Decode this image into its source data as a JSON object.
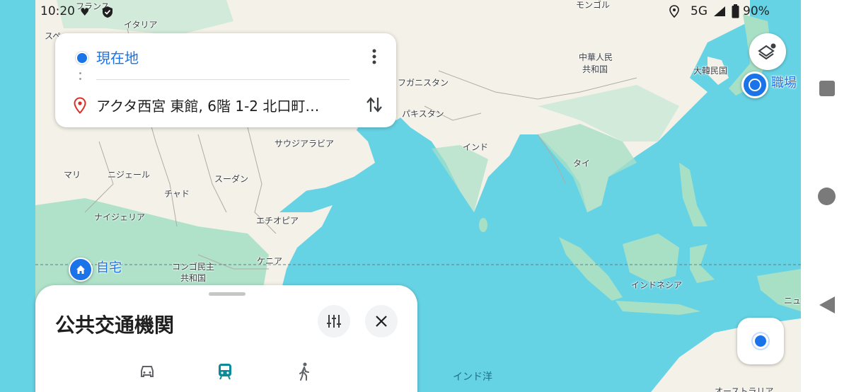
{
  "status_bar": {
    "time": "10:20",
    "network": "5G",
    "battery": "90%"
  },
  "map": {
    "labels": {
      "france": "フランス",
      "italy": "イタリア",
      "spain": "スペ",
      "mongolia": "モンゴル",
      "china_line1": "中華人民",
      "china_line2": "共和国",
      "korea": "大韓民国",
      "afghanistan": "フガニスタン",
      "pakistan": "パキスタン",
      "india": "インド",
      "saudi": "サウジアラビア",
      "mali": "マリ",
      "niger": "ニジェール",
      "chad": "チャド",
      "sudan": "スーダン",
      "nigeria": "ナイジェリア",
      "ethiopia": "エチオピア",
      "thailand": "タイ",
      "drc_line1": "コンゴ民主",
      "drc_line2": "共和国",
      "kenya": "ケニア",
      "indonesia": "インドネシア",
      "new_guinea": "ニュ",
      "indian_ocean": "インド洋",
      "australia": "オーストラリア"
    },
    "places": {
      "home": "自宅",
      "work": "職場"
    }
  },
  "route": {
    "origin": "現在地",
    "destination": "アクタ西宮 東館, 6階 1-2 北口町…"
  },
  "sheet": {
    "title": "公共交通機関",
    "modes": [
      "drive",
      "transit",
      "walk"
    ],
    "selected_mode": "transit"
  },
  "colors": {
    "water": "#66d3e4",
    "land": "#f5f2ea",
    "green": "#a8e0c6",
    "accent": "#1a73e8",
    "pin": "#d93025",
    "transit_selected": "#0b8a99"
  }
}
